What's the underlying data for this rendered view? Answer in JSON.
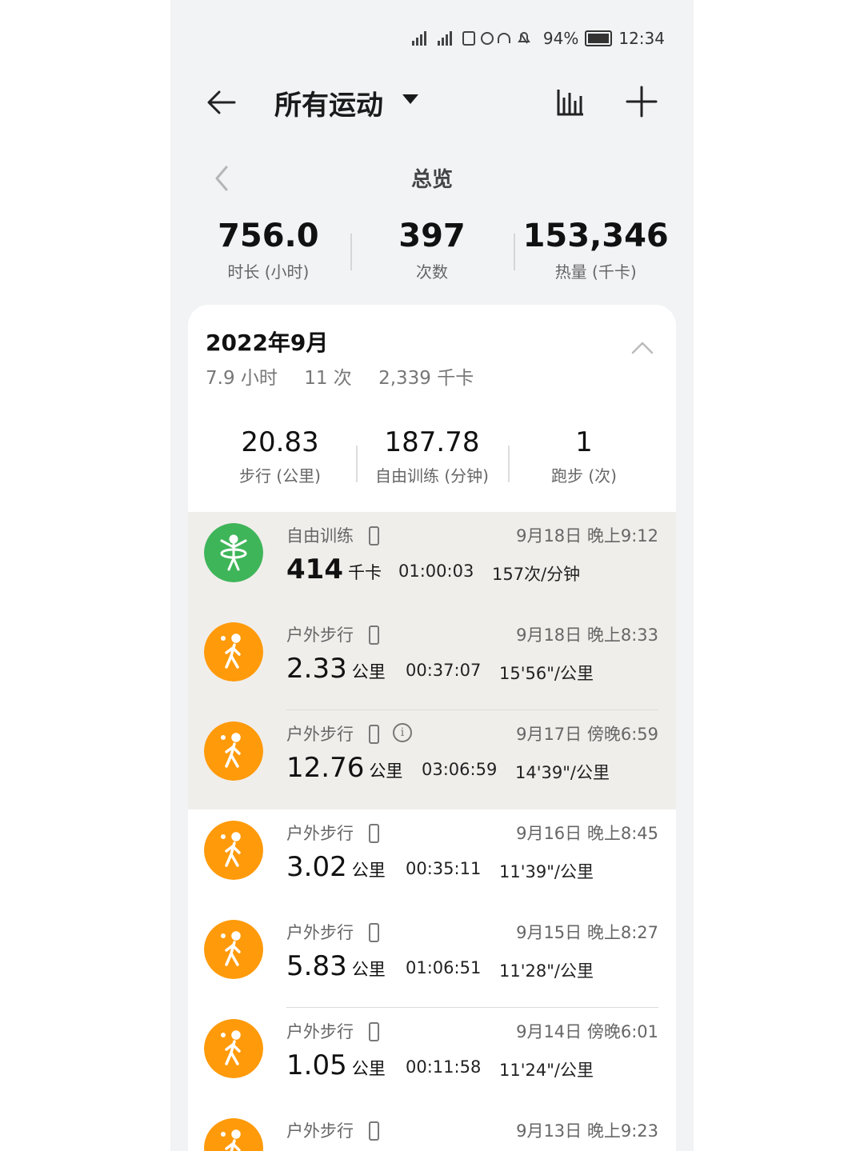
{
  "status": {
    "battery": "94%",
    "time": "12:34"
  },
  "header": {
    "title": "所有运动"
  },
  "overview": {
    "title": "总览",
    "stats": [
      {
        "value": "756.0",
        "label": "时长 (小时)"
      },
      {
        "value": "397",
        "label": "次数"
      },
      {
        "value": "153,346",
        "label": "热量 (千卡)"
      }
    ]
  },
  "month": {
    "title": "2022年9月",
    "summary": [
      "7.9 小时",
      "11 次",
      "2,339 千卡"
    ],
    "stats": [
      {
        "value": "20.83",
        "label": "步行 (公里)"
      },
      {
        "value": "187.78",
        "label": "自由训练 (分钟)"
      },
      {
        "value": "1",
        "label": "跑步 (次)"
      }
    ]
  },
  "colors": {
    "green": "#3fb55a",
    "orange": "#ff9a0a"
  },
  "records": [
    {
      "name": "自由训练",
      "icon": "free-training-icon",
      "time": "9月18日 晚上9:12",
      "value": "414",
      "unit": "千卡",
      "duration": "01:00:03",
      "third": "157次/分钟",
      "info": false
    },
    {
      "name": "户外步行",
      "icon": "walking-icon",
      "time": "9月18日 晚上8:33",
      "value": "2.33",
      "unit": "公里",
      "duration": "00:37:07",
      "third": "15'56\"/公里",
      "info": false
    },
    {
      "name": "户外步行",
      "icon": "walking-icon",
      "time": "9月17日 傍晚6:59",
      "value": "12.76",
      "unit": "公里",
      "duration": "03:06:59",
      "third": "14'39\"/公里",
      "info": true
    },
    {
      "name": "户外步行",
      "icon": "walking-icon",
      "time": "9月16日 晚上8:45",
      "value": "3.02",
      "unit": "公里",
      "duration": "00:35:11",
      "third": "11'39\"/公里",
      "info": false
    },
    {
      "name": "户外步行",
      "icon": "walking-icon",
      "time": "9月15日 晚上8:27",
      "value": "5.83",
      "unit": "公里",
      "duration": "01:06:51",
      "third": "11'28\"/公里",
      "info": false
    },
    {
      "name": "户外步行",
      "icon": "walking-icon",
      "time": "9月14日 傍晚6:01",
      "value": "1.05",
      "unit": "公里",
      "duration": "00:11:58",
      "third": "11'24\"/公里",
      "info": false
    },
    {
      "name": "户外步行",
      "icon": "walking-icon",
      "time": "9月13日 晚上9:23",
      "value": "",
      "unit": "",
      "duration": "",
      "third": "",
      "info": false
    }
  ]
}
